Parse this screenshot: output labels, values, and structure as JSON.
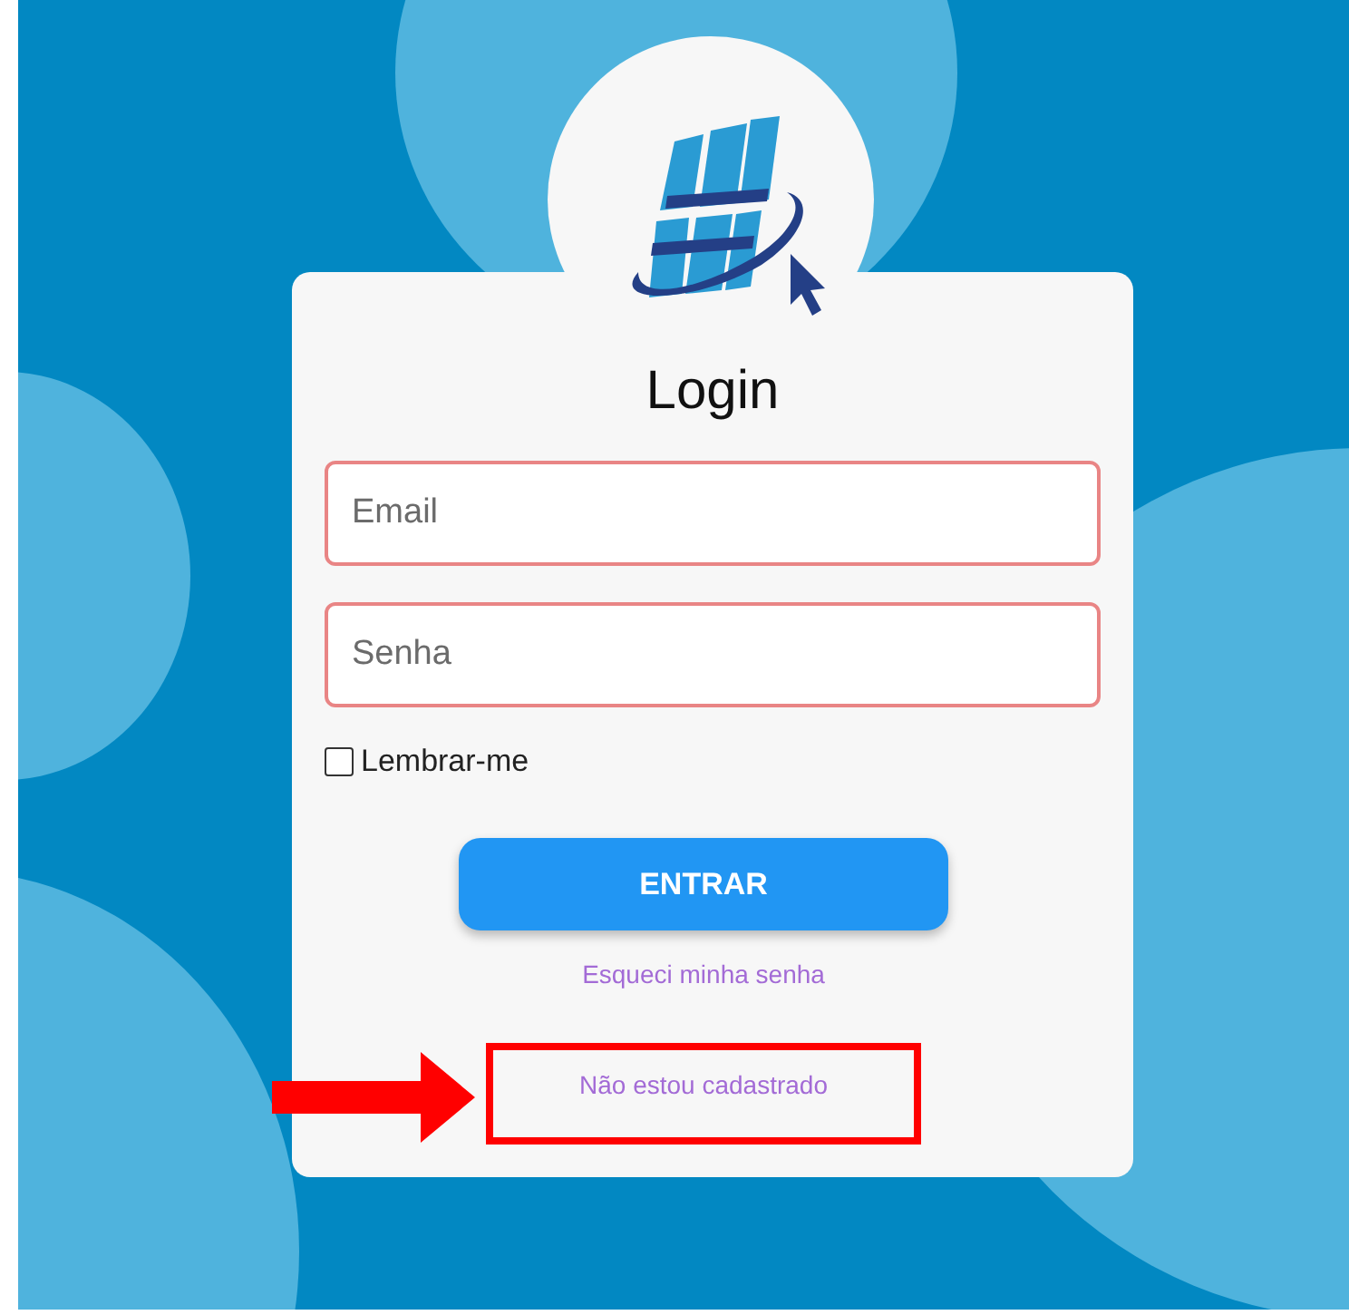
{
  "title": "Login",
  "fields": [
    {
      "placeholder": "Email",
      "invalid": true
    },
    {
      "placeholder": "Senha",
      "invalid": true
    }
  ],
  "remember": {
    "label": "Lembrar-me",
    "checked": false
  },
  "submit": "ENTRAR",
  "forgot": "Esqueci minha senha",
  "register": {
    "label": "Não estou cadastrado",
    "highlighted": true
  }
}
